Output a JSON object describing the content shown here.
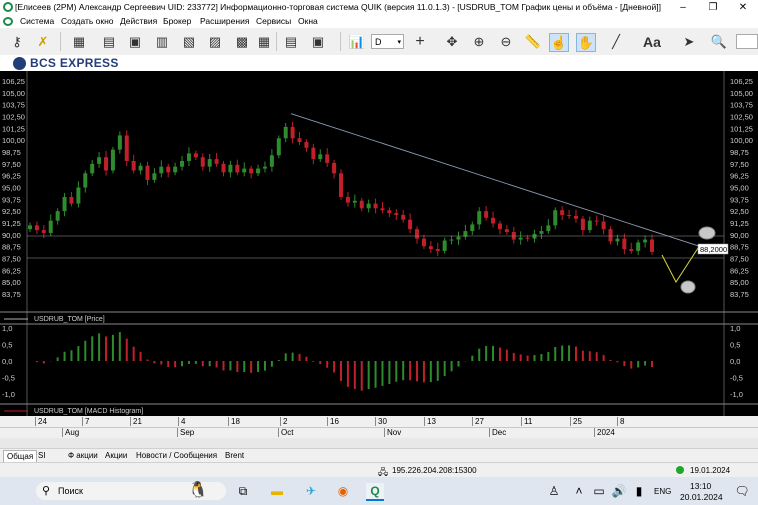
{
  "window": {
    "title": "[Елисеев (2PM) Александр Сергеевич UID: 233772] Информационно-торговая система QUIK (версия 11.0.1.3) - [USDRUB_TOM График цены и объёма - [Дневной]]",
    "controls": [
      "–",
      "❐",
      "✕"
    ]
  },
  "menu": [
    "Система",
    "Создать окно",
    "Действия",
    "Брокер",
    "Расширения",
    "Сервисы",
    "Окна"
  ],
  "toolbar": {
    "period": "D",
    "font_label": "Aa"
  },
  "brand": "BCS EXPRESS",
  "chart_data": {
    "type": "candlestick",
    "instrument": "USDRUB_TOM",
    "price_axis": [
      "106,25",
      "105,00",
      "103,75",
      "102,50",
      "101,25",
      "100,00",
      "98,75",
      "97,50",
      "96,25",
      "95,00",
      "93,75",
      "92,50",
      "91,25",
      "90,00",
      "88,75",
      "87,50",
      "86,25",
      "85,00",
      "83,75"
    ],
    "price_range": [
      83.0,
      107.0
    ],
    "last_price": "88,2000",
    "price_legend": "USDRUB_TOM [Price]",
    "macd_axis": [
      "1,0",
      "0,5",
      "0,0",
      "-0,5",
      "-1,0"
    ],
    "macd_legend": "USDRUB_TOM [MACD Histogram]",
    "trendline_start": {
      "x": "7 Sep 2023",
      "y": 102.8
    },
    "trendline_end": {
      "x": "18 Jan 2024",
      "y": 88.6
    },
    "grid": false,
    "date_labels": [
      "24",
      "7",
      "21",
      "4",
      "18",
      "2",
      "16",
      "30",
      "13",
      "27",
      "11",
      "25",
      "8"
    ],
    "month_labels": [
      "Aug",
      "Sep",
      "Oct",
      "Nov",
      "Dec",
      "2024"
    ],
    "up_color": "#2e8b2e",
    "down_color": "#c0202a"
  },
  "tabs": [
    "Общая",
    "SI",
    "Ф акции",
    "Акции",
    "Новости / Сообщения",
    "Brent"
  ],
  "status": {
    "connection": "195.226.204.208:15300",
    "date": "19.01.2024"
  },
  "taskbar": {
    "search": "Поиск",
    "lang": "ENG",
    "time": "13:10",
    "date": "20.01.2024"
  }
}
